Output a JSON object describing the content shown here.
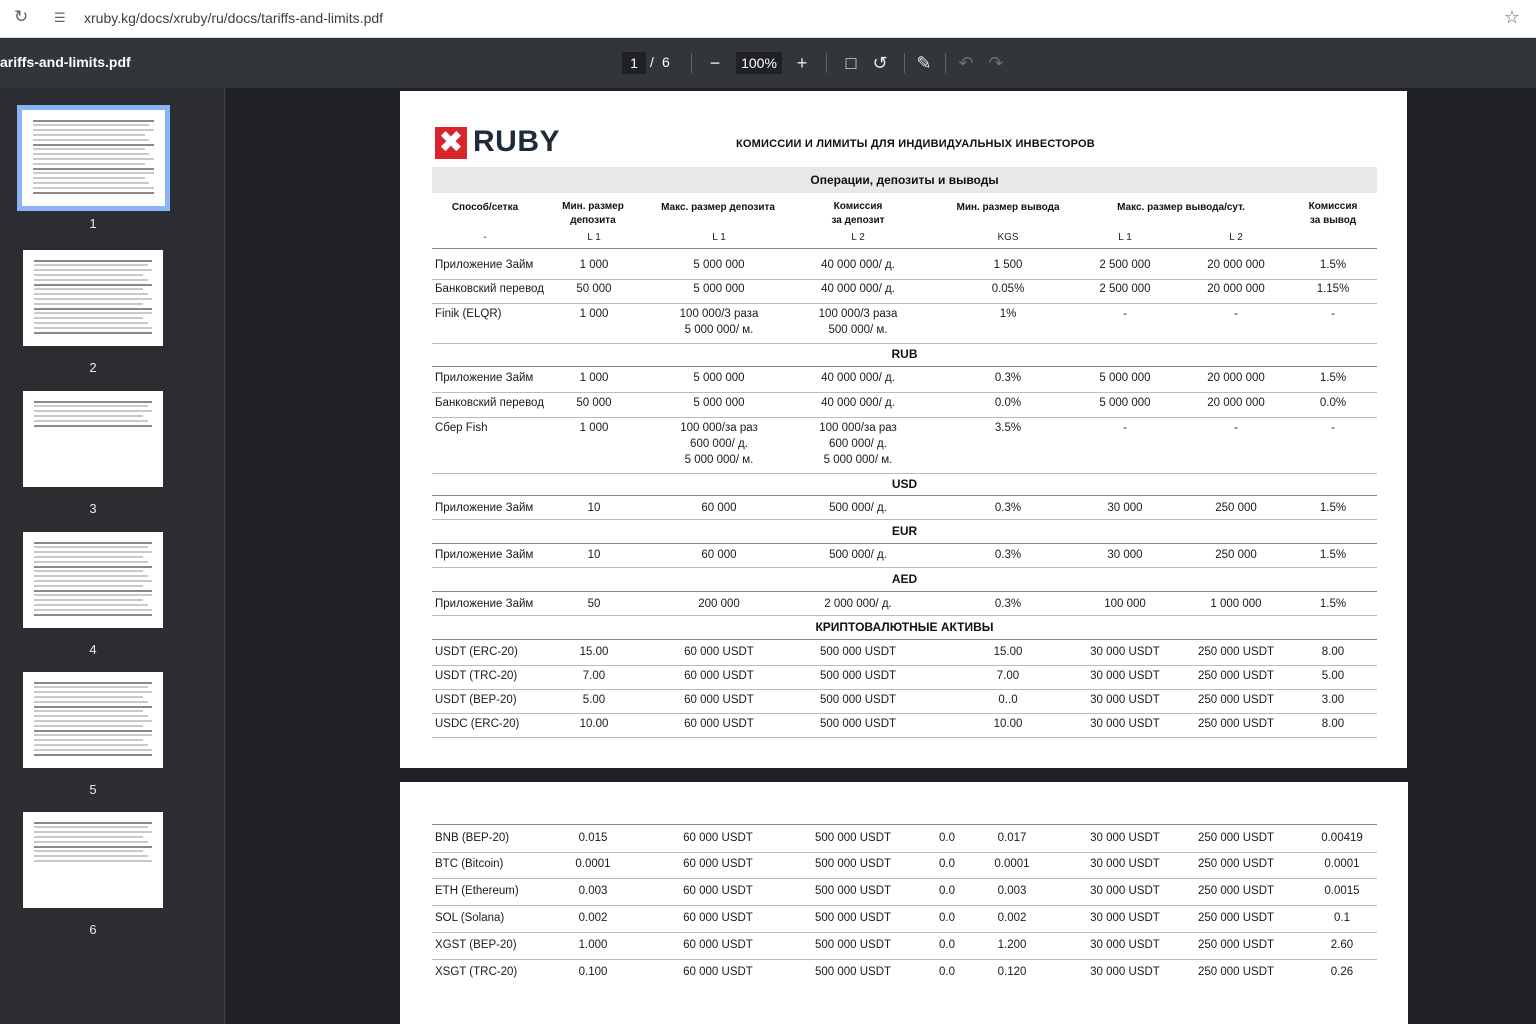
{
  "browser": {
    "url": "xruby.kg/docs/xruby/ru/docs/tariffs-and-limits.pdf"
  },
  "toolbar": {
    "filename": "ariffs-and-limits.pdf",
    "current_page": "1",
    "separator": "/",
    "total_pages": "6",
    "zoom": "100%"
  },
  "thumbnails": [
    {
      "label": "1",
      "active": true
    },
    {
      "label": "2",
      "active": false
    },
    {
      "label": "3",
      "active": false
    },
    {
      "label": "4",
      "active": false
    },
    {
      "label": "5",
      "active": false
    },
    {
      "label": "6",
      "active": false
    }
  ],
  "document": {
    "logo_text": "RUBY",
    "title": "КОМИССИИ И ЛИМИТЫ ДЛЯ ИНДИВИДУАЛЬНЫХ ИНВЕСТОРОВ",
    "band_title": "Операции, депозиты и выводы",
    "headers": [
      "Способ/сетка",
      "Мин. размер\nдепозита",
      "Макс. размер депозита",
      "Комиссия\nза депозит",
      "Мин. размер вывода",
      "Макс. размер вывода/сут.",
      "Комиссия\nза вывод"
    ],
    "subheaders": [
      "-",
      "L 1",
      "L 1",
      "L 2",
      "KGS",
      "L 1",
      "L 2"
    ],
    "kgs_rows": [
      [
        "Приложение Займ",
        "1 000",
        "5 000 000",
        "40 000 000/ д.",
        "1 500",
        "2 500 000",
        "20 000 000",
        "1.5%"
      ],
      [
        "Банковский перевод",
        "50 000",
        "5 000 000",
        "40 000 000/ д.",
        "0.05%",
        "2 500 000",
        "20 000 000",
        "1.15%"
      ],
      [
        "Finik (ELQR)",
        "1 000",
        "100 000/3 раза\n5 000 000/ м.",
        "100 000/3 раза\n500 000/ м.",
        "1%",
        "-",
        "-",
        "-"
      ]
    ],
    "sections": {
      "rub": "RUB",
      "usd": "USD",
      "eur": "EUR",
      "aed": "AED",
      "crypto": "КРИПТОВАЛЮТНЫЕ АКТИВЫ"
    },
    "rub_rows": [
      [
        "Приложение Займ",
        "1 000",
        "5 000 000",
        "40 000 000/ д.",
        "0.3%",
        "5 000 000",
        "20 000 000",
        "1.5%"
      ],
      [
        "Банковский перевод",
        "50 000",
        "5 000 000",
        "40 000 000/ д.",
        "0.0%",
        "5 000 000",
        "20 000 000",
        "0.0%"
      ],
      [
        "Сбер Fish",
        "1 000",
        "100 000/за раз\n600 000/ д.\n5 000 000/ м.",
        "100 000/за раз\n600 000/ д.\n5 000 000/ м.",
        "3.5%",
        "-",
        "-",
        "-"
      ]
    ],
    "usd_row": [
      "Приложение Займ",
      "10",
      "60 000",
      "500 000/ д.",
      "0.3%",
      "30 000",
      "250 000",
      "1.5%"
    ],
    "eur_row": [
      "Приложение Займ",
      "10",
      "60 000",
      "500 000/ д.",
      "0.3%",
      "30 000",
      "250 000",
      "1.5%"
    ],
    "aed_row": [
      "Приложение Займ",
      "50",
      "200 000",
      "2 000 000/ д.",
      "0.3%",
      "100 000",
      "1 000 000",
      "1.5%"
    ],
    "crypto_rows": [
      [
        "USDT (ERC-20)",
        "15.00",
        "60 000 USDT",
        "500 000 USDT",
        "15.00",
        "30 000 USDT",
        "250 000 USDT",
        "8.00"
      ],
      [
        "USDT (TRC-20)",
        "7.00",
        "60 000 USDT",
        "500 000 USDT",
        "7.00",
        "30 000 USDT",
        "250 000 USDT",
        "5.00"
      ],
      [
        "USDT (BEP-20)",
        "5.00",
        "60 000 USDT",
        "500 000 USDT",
        "0..0",
        "30 000 USDT",
        "250 000 USDT",
        "3.00"
      ],
      [
        "USDC (ERC-20)",
        "10.00",
        "60 000 USDT",
        "500 000 USDT",
        "10.00",
        "30 000 USDT",
        "250 000 USDT",
        "8.00"
      ]
    ],
    "page2_rows": [
      [
        "BNB (BEP-20)",
        "0.015",
        "60 000 USDT",
        "500 000 USDT",
        "0.0",
        "0.017",
        "30 000 USDT",
        "250 000 USDT",
        "0.00419"
      ],
      [
        "BTC (Bitcoin)",
        "0.0001",
        "60 000 USDT",
        "500 000 USDT",
        "0.0",
        "0.0001",
        "30 000 USDT",
        "250 000 USDT",
        "0.0001"
      ],
      [
        "ETH (Ethereum)",
        "0.003",
        "60 000 USDT",
        "500 000 USDT",
        "0.0",
        "0.003",
        "30 000 USDT",
        "250 000 USDT",
        "0.0015"
      ],
      [
        "SOL (Solana)",
        "0.002",
        "60 000 USDT",
        "500 000 USDT",
        "0.0",
        "0.002",
        "30 000 USDT",
        "250 000 USDT",
        "0.1"
      ],
      [
        "XGST (BEP-20)",
        "1.000",
        "60 000 USDT",
        "500 000 USDT",
        "0.0",
        "1.200",
        "30 000 USDT",
        "250 000 USDT",
        "2.60"
      ],
      [
        "XSGT (TRC-20)",
        "0.100",
        "60 000 USDT",
        "500 000 USDT",
        "0.0",
        "0.120",
        "30 000 USDT",
        "250 000 USDT",
        "0.26"
      ]
    ]
  },
  "icons": {
    "reload": "reload-icon",
    "site_settings": "tune-icon",
    "bookmark": "star-icon",
    "zoom_out": "minus-icon",
    "zoom_in": "plus-icon",
    "fit": "fit-page-icon",
    "rotate": "rotate-icon",
    "annotate": "pen-icon",
    "undo": "undo-icon",
    "redo": "redo-icon"
  },
  "colors": {
    "logo_red": "#d9232d",
    "thumb_active": "#8ab4f8",
    "toolbar_bg": "#323639"
  }
}
